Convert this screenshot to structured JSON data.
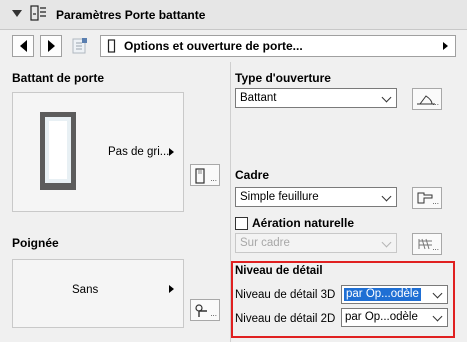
{
  "header": {
    "title": "Paramètres Porte battante"
  },
  "nav": {
    "selected_page": "Options et ouverture de porte..."
  },
  "left": {
    "battant_title": "Battant de porte",
    "battant_preview_label": "Pas de gri...",
    "poignee_title": "Poignée",
    "poignee_value": "Sans"
  },
  "right": {
    "type_title": "Type d'ouverture",
    "type_value": "Battant",
    "cadre_title": "Cadre",
    "cadre_value": "Simple feuillure",
    "aeration_label": "Aération naturelle",
    "aeration_checked": false,
    "aeration_select_value": "Sur cadre",
    "detail_title": "Niveau de détail",
    "detail_3d_label": "Niveau de détail 3D",
    "detail_3d_value": "par Op...odèle",
    "detail_2d_label": "Niveau de détail 2D",
    "detail_2d_value": "par Op...odèle"
  },
  "colors": {
    "highlight": "#e02020",
    "selection": "#1f6fd4"
  }
}
